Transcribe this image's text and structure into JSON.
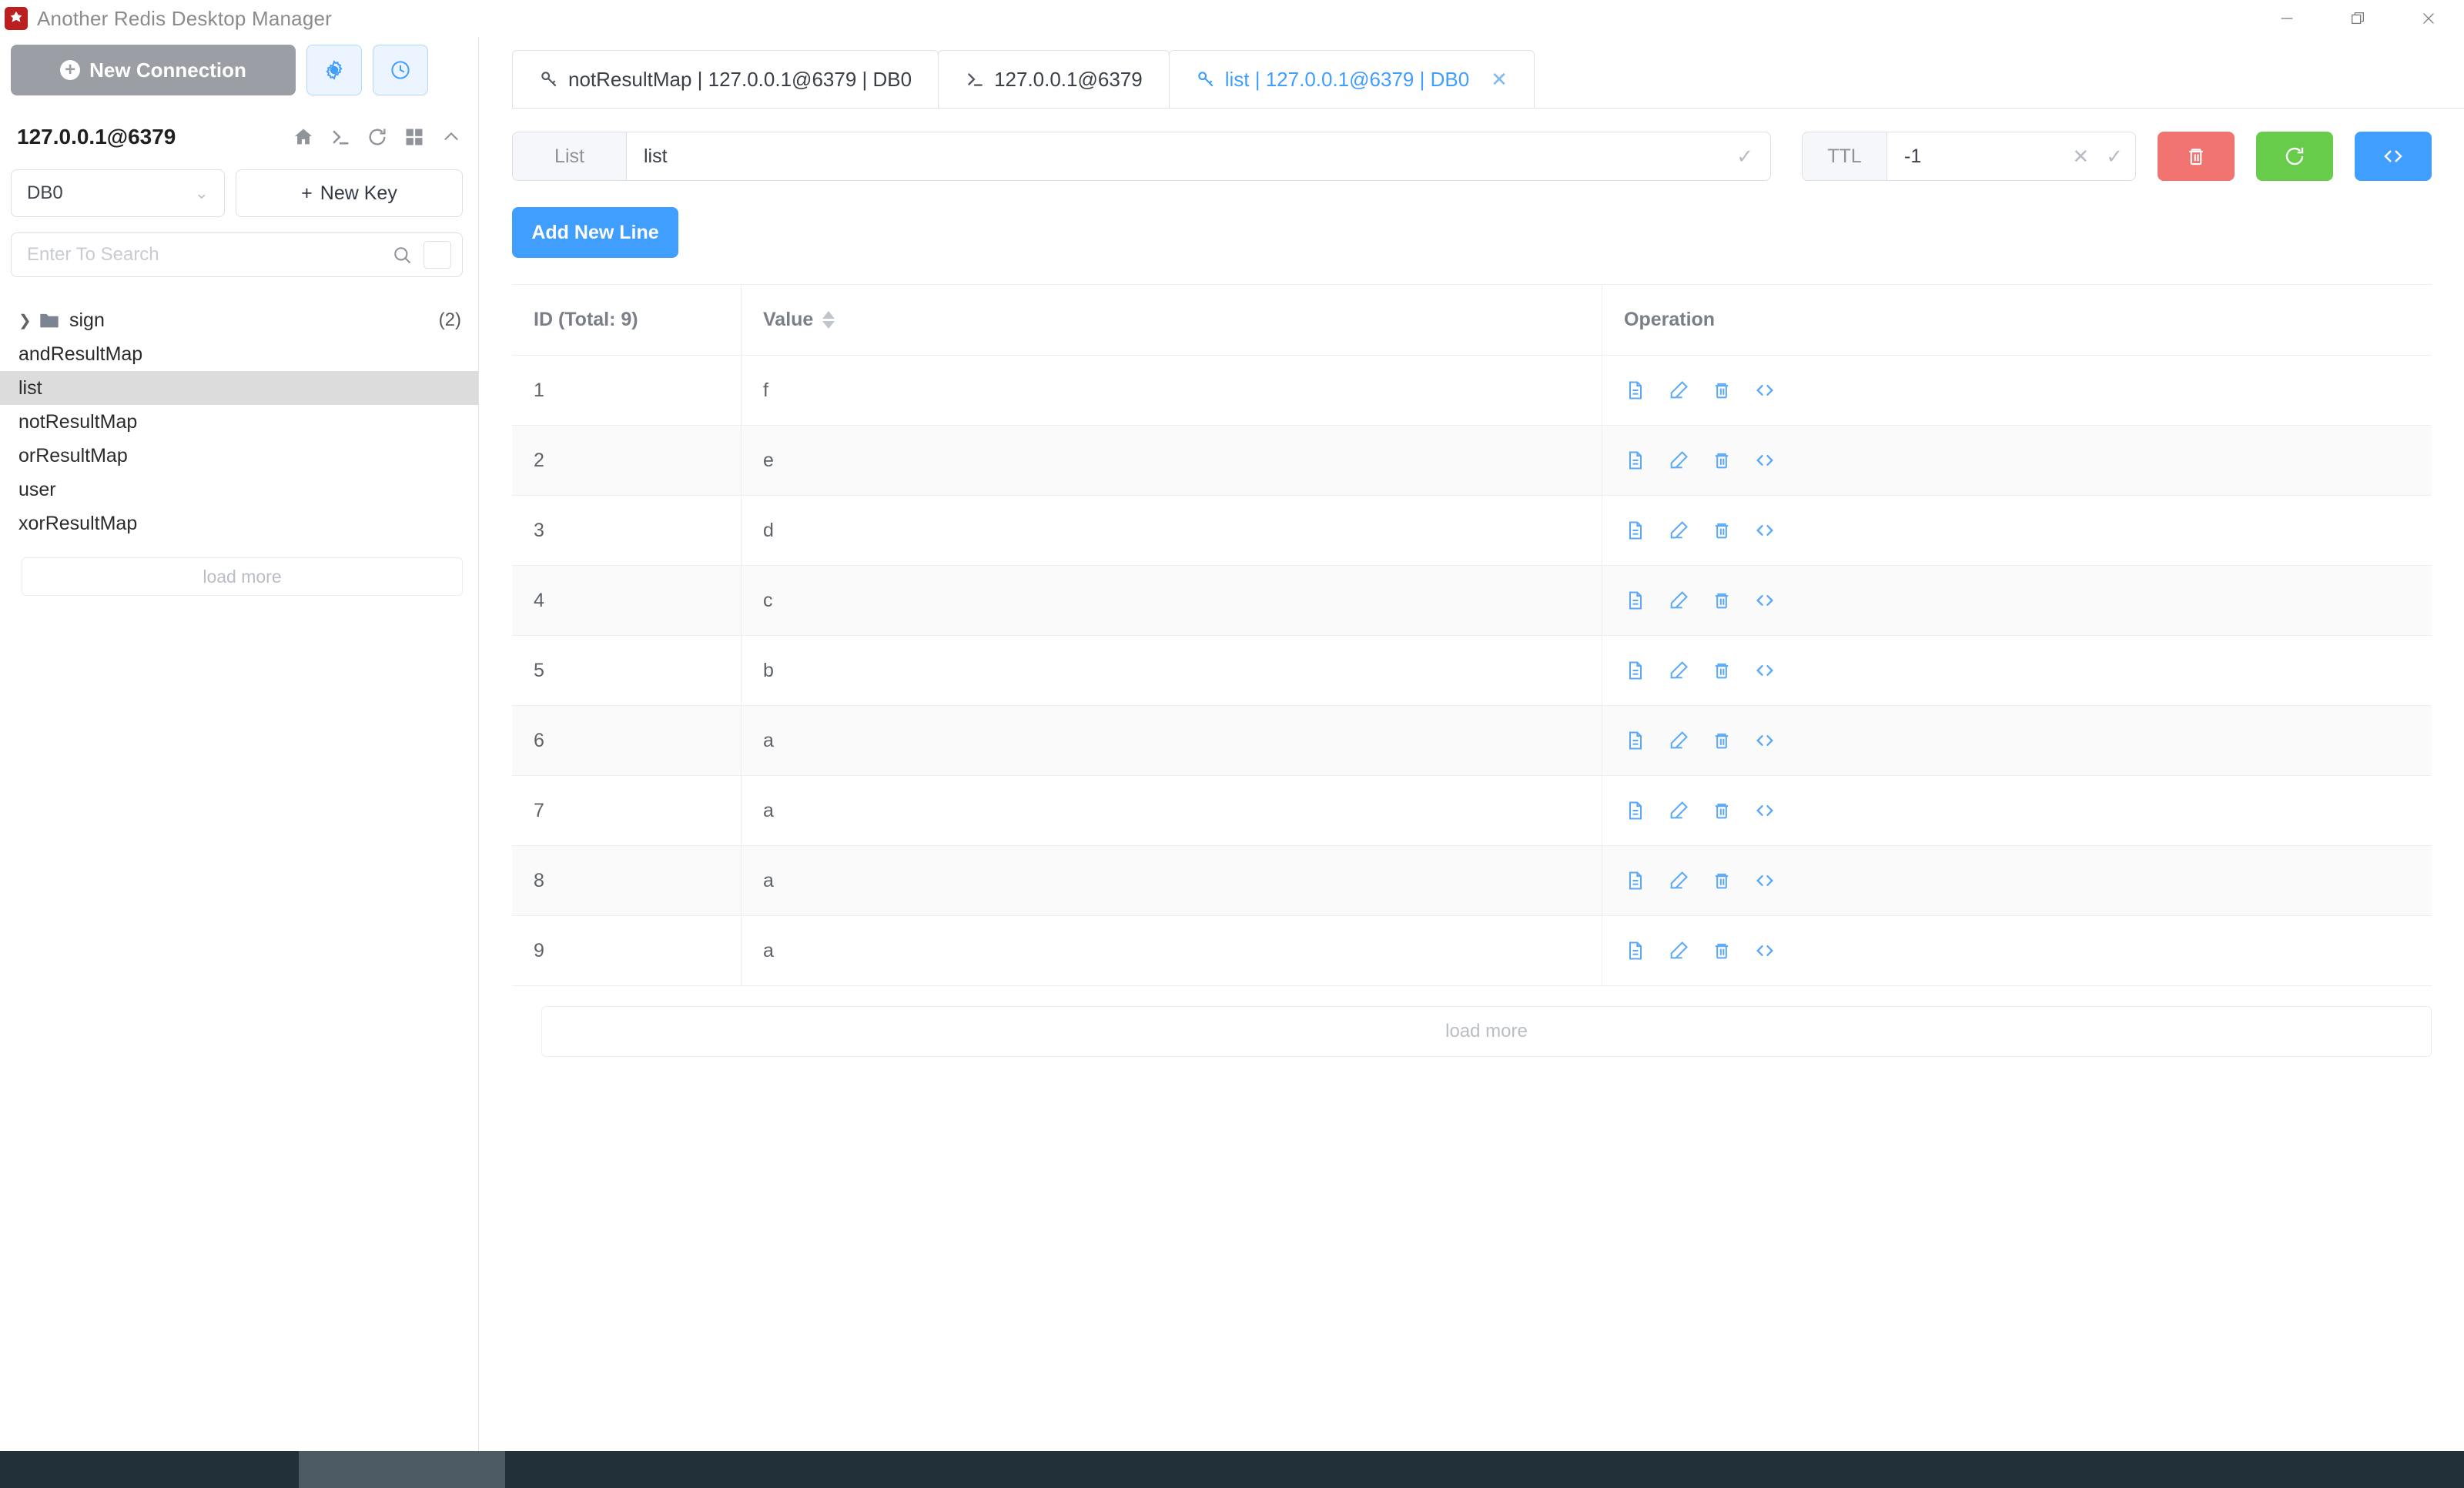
{
  "window": {
    "title": "Another Redis Desktop Manager",
    "controls": {
      "minimize": "minimize-icon",
      "maximize": "maximize-icon",
      "close": "close-icon"
    }
  },
  "sidebar": {
    "new_connection_label": "New Connection",
    "settings_icon": "gear-icon",
    "history_icon": "clock-icon",
    "connection_name": "127.0.0.1@6379",
    "header_icons": [
      "home-icon",
      "terminal-icon",
      "refresh-icon",
      "grid-icon",
      "chevron-up-icon"
    ],
    "db_selected": "DB0",
    "new_key_label": "New Key",
    "search_placeholder": "Enter To Search",
    "keys": [
      {
        "label": "sign",
        "type": "folder",
        "count": "(2)",
        "selected": false
      },
      {
        "label": "andResultMap",
        "type": "key",
        "count": "",
        "selected": false
      },
      {
        "label": "list",
        "type": "key",
        "count": "",
        "selected": true
      },
      {
        "label": "notResultMap",
        "type": "key",
        "count": "",
        "selected": false
      },
      {
        "label": "orResultMap",
        "type": "key",
        "count": "",
        "selected": false
      },
      {
        "label": "user",
        "type": "key",
        "count": "",
        "selected": false
      },
      {
        "label": "xorResultMap",
        "type": "key",
        "count": "",
        "selected": false
      }
    ],
    "load_more_label": "load more"
  },
  "tabs": [
    {
      "label": "notResultMap | 127.0.0.1@6379 | DB0",
      "icon": "key-icon",
      "active": false,
      "closable": false
    },
    {
      "label": "127.0.0.1@6379",
      "icon": "terminal-icon",
      "active": false,
      "closable": false
    },
    {
      "label": "list | 127.0.0.1@6379 | DB0",
      "icon": "key-icon",
      "active": true,
      "closable": true
    }
  ],
  "keybar": {
    "key_type": "List",
    "key_name": "list",
    "ttl_label": "TTL",
    "ttl_value": "-1",
    "delete_icon": "trash-icon",
    "refresh_icon": "refresh-icon",
    "code_icon": "code-icon"
  },
  "content": {
    "add_new_line_label": "Add New Line",
    "columns": {
      "id": "ID (Total: 9)",
      "value": "Value",
      "operation": "Operation"
    },
    "rows": [
      {
        "id": "1",
        "value": "f"
      },
      {
        "id": "2",
        "value": "e"
      },
      {
        "id": "3",
        "value": "d"
      },
      {
        "id": "4",
        "value": "c"
      },
      {
        "id": "5",
        "value": "b"
      },
      {
        "id": "6",
        "value": "a"
      },
      {
        "id": "7",
        "value": "a"
      },
      {
        "id": "8",
        "value": "a"
      },
      {
        "id": "9",
        "value": "a"
      }
    ],
    "row_operations": [
      "detail-icon",
      "edit-icon",
      "delete-icon",
      "code-icon"
    ],
    "load_more_label": "load more"
  },
  "colors": {
    "accent": "#409eff",
    "danger": "#f17470",
    "success": "#66cc4a",
    "sidebar_selected": "#dcdcdc",
    "brand_red": "#bb1f1f"
  }
}
